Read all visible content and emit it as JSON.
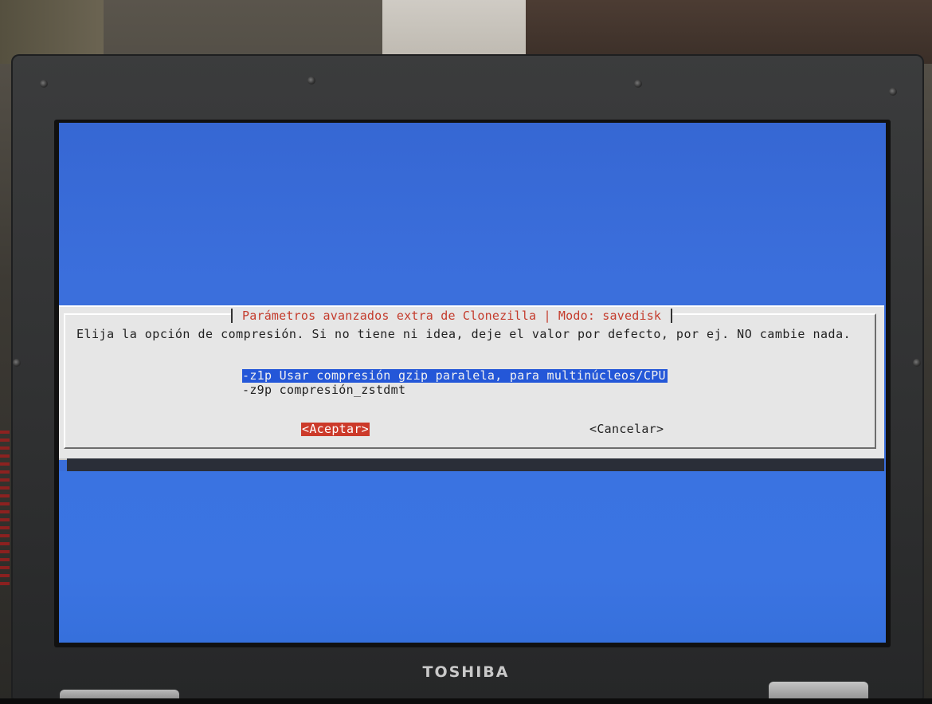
{
  "dialog": {
    "title": "Parámetros avanzados extra de Clonezilla | Modo: savedisk",
    "prompt": "Elija la opción de compresión. Si no tiene ni idea, deje el valor por defecto, por ej. NO cambie nada.",
    "options": [
      {
        "label": "-z1p Usar compresión gzip paralela, para multinúcleos/CPU",
        "selected": true
      },
      {
        "label": "-z9p compresión_zstdmt",
        "selected": false
      }
    ],
    "buttons": {
      "ok": "<Aceptar>",
      "cancel": "<Cancelar>"
    }
  },
  "laptop": {
    "brand": "TOSHIBA"
  },
  "colors": {
    "screen_background": "#3a6ed9",
    "dialog_background": "#e6e6e6",
    "title_text": "#c43b2c",
    "selection_highlight": "#2457d8",
    "ok_button": "#cc3a2a"
  }
}
